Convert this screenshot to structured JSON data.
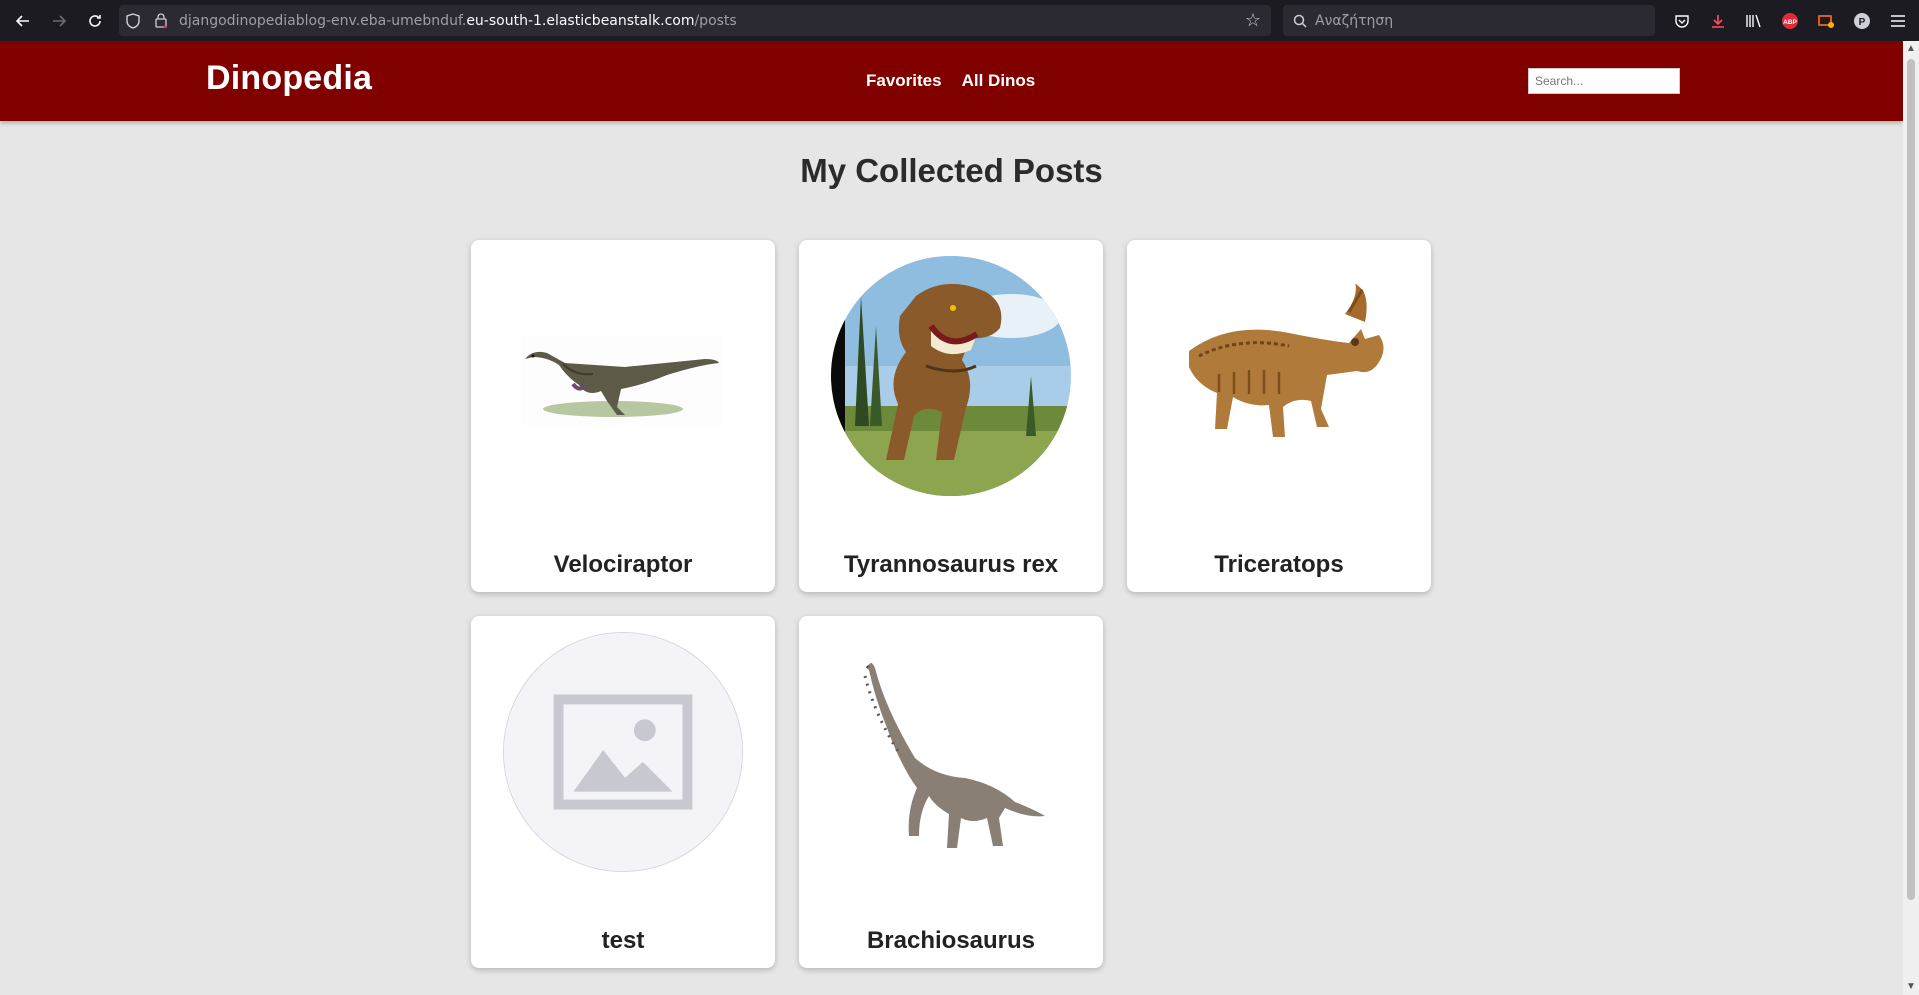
{
  "browser": {
    "url_prefix": "djangodinopediablog-env.eba-umebnduf.",
    "url_host": "eu-south-1.elasticbeanstalk.com",
    "url_path": "/posts",
    "search_placeholder": "Αναζήτηση",
    "abp_label": "ABP",
    "profile_initial": "P"
  },
  "header": {
    "brand": "Dinopedia",
    "nav": [
      "Favorites",
      "All Dinos"
    ],
    "search_placeholder": "Search..."
  },
  "main": {
    "title": "My Collected Posts",
    "posts": [
      {
        "title": "Velociraptor",
        "image": "velociraptor-illustration"
      },
      {
        "title": "Tyrannosaurus rex",
        "image": "trex-illustration"
      },
      {
        "title": "Triceratops",
        "image": "triceratops-skeleton"
      },
      {
        "title": "test",
        "image": "image-placeholder-icon"
      },
      {
        "title": "Brachiosaurus",
        "image": "brachiosaurus-illustration"
      }
    ]
  },
  "colors": {
    "header_bg": "#800000",
    "page_bg": "#e6e6e6",
    "chrome_bg": "#1c1b22"
  }
}
